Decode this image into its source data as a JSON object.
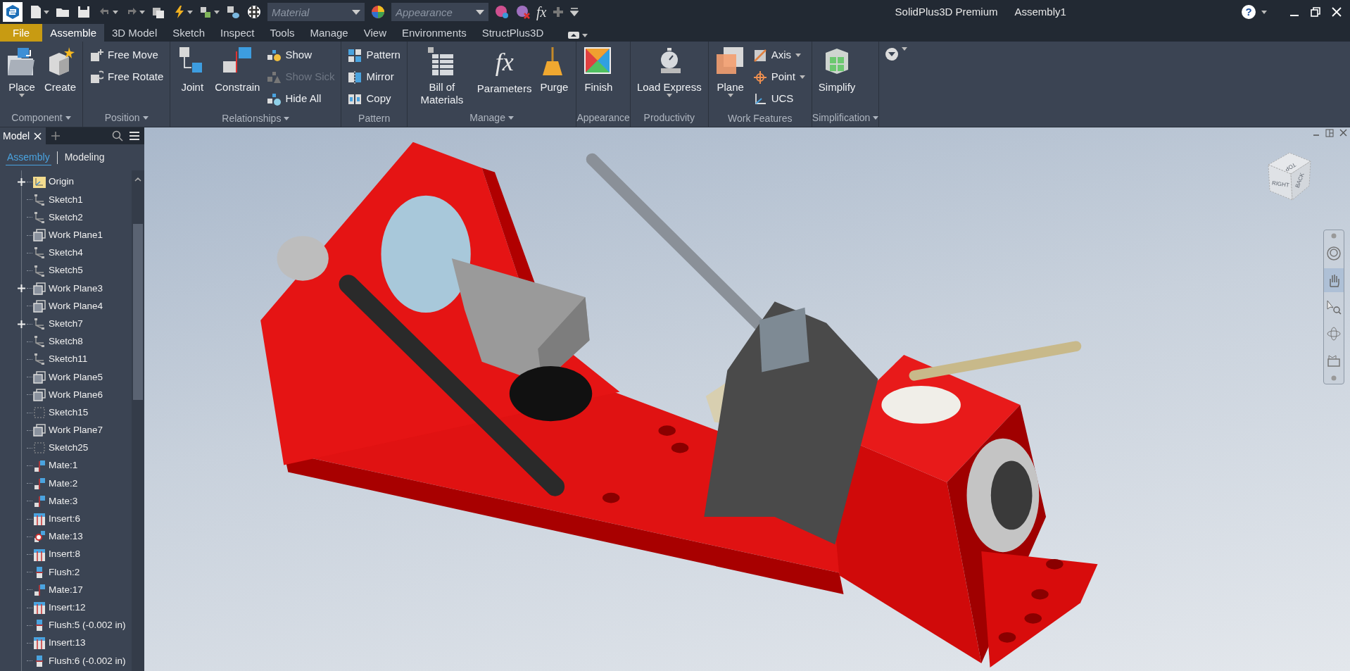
{
  "title_bar": {
    "material_placeholder": "Material",
    "appearance_placeholder": "Appearance",
    "fx_glyph": "fx",
    "app_name": "SolidPlus3D Premium",
    "document": "Assembly1",
    "help": "?"
  },
  "tabs": [
    {
      "label": "File",
      "kind": "file",
      "selected": false
    },
    {
      "label": "Assemble",
      "kind": "tab",
      "selected": true
    },
    {
      "label": "3D Model",
      "kind": "tab",
      "selected": false
    },
    {
      "label": "Sketch",
      "kind": "tab",
      "selected": false
    },
    {
      "label": "Inspect",
      "kind": "tab",
      "selected": false
    },
    {
      "label": "Tools",
      "kind": "tab",
      "selected": false
    },
    {
      "label": "Manage",
      "kind": "tab",
      "selected": false
    },
    {
      "label": "View",
      "kind": "tab",
      "selected": false
    },
    {
      "label": "Environments",
      "kind": "tab",
      "selected": false
    },
    {
      "label": "StructPlus3D",
      "kind": "tab",
      "selected": false
    }
  ],
  "ribbon": {
    "panels": [
      {
        "label": "Component",
        "dropdown": true,
        "tools": [
          {
            "kind": "large",
            "label": "Place",
            "caret": true
          },
          {
            "kind": "large",
            "label": "Create",
            "caret": false
          }
        ]
      },
      {
        "label": "Position",
        "dropdown": true,
        "tools": [
          {
            "kind": "stack",
            "items": [
              {
                "label": "Free Move",
                "disabled": false,
                "caret": false
              },
              {
                "label": "Free Rotate",
                "disabled": false,
                "caret": false
              }
            ]
          }
        ]
      },
      {
        "label": "Relationships",
        "dropdown": true,
        "tools": [
          {
            "kind": "large",
            "label": "Joint",
            "caret": false
          },
          {
            "kind": "large",
            "label": "Constrain",
            "caret": false
          },
          {
            "kind": "stack",
            "items": [
              {
                "label": "Show",
                "disabled": false,
                "caret": false
              },
              {
                "label": "Show Sick",
                "disabled": true,
                "caret": false
              },
              {
                "label": "Hide All",
                "disabled": false,
                "caret": false
              }
            ]
          }
        ]
      },
      {
        "label": "Pattern",
        "dropdown": false,
        "tools": [
          {
            "kind": "stack",
            "items": [
              {
                "label": "Pattern",
                "disabled": false,
                "caret": false
              },
              {
                "label": "Mirror",
                "disabled": false,
                "caret": false
              },
              {
                "label": "Copy",
                "disabled": false,
                "caret": false
              }
            ]
          }
        ]
      },
      {
        "label": "Manage",
        "dropdown": true,
        "tools": [
          {
            "kind": "large",
            "label": "Bill of Materials",
            "caret": false
          },
          {
            "kind": "large",
            "label": "Parameters",
            "glyph": "fx",
            "caret": false
          },
          {
            "kind": "large",
            "label": "Purge",
            "caret": false
          }
        ]
      },
      {
        "label": "Appearance",
        "dropdown": false,
        "tools": [
          {
            "kind": "large",
            "label": "Finish",
            "caret": false
          }
        ]
      },
      {
        "label": "Productivity",
        "dropdown": false,
        "tools": [
          {
            "kind": "large",
            "label": "Load Express",
            "caret": true
          }
        ]
      },
      {
        "label": "Work Features",
        "dropdown": false,
        "tools": [
          {
            "kind": "large",
            "label": "Plane",
            "caret": true
          },
          {
            "kind": "stack",
            "items": [
              {
                "label": "Axis",
                "disabled": false,
                "caret": true
              },
              {
                "label": "Point",
                "disabled": false,
                "caret": true
              },
              {
                "label": "UCS",
                "disabled": false,
                "caret": false
              }
            ]
          }
        ]
      },
      {
        "label": "Simplification",
        "dropdown": true,
        "tools": [
          {
            "kind": "large",
            "label": "Simplify",
            "caret": false
          }
        ]
      }
    ]
  },
  "browser": {
    "tab": "Model",
    "subtabs": [
      {
        "label": "Assembly",
        "selected": true
      },
      {
        "label": "Modeling",
        "selected": false
      }
    ],
    "items": [
      {
        "label": "Origin",
        "kind": "origin",
        "expandable": true
      },
      {
        "label": "Sketch1",
        "kind": "sketch",
        "expandable": false
      },
      {
        "label": "Sketch2",
        "kind": "sketch",
        "expandable": false
      },
      {
        "label": "Work Plane1",
        "kind": "plane",
        "expandable": false
      },
      {
        "label": "Sketch4",
        "kind": "sketch",
        "expandable": false
      },
      {
        "label": "Sketch5",
        "kind": "sketch",
        "expandable": false
      },
      {
        "label": "Work Plane3",
        "kind": "plane",
        "expandable": true
      },
      {
        "label": "Work Plane4",
        "kind": "plane",
        "expandable": false
      },
      {
        "label": "Sketch7",
        "kind": "sketch",
        "expandable": true
      },
      {
        "label": "Sketch8",
        "kind": "sketch",
        "expandable": false
      },
      {
        "label": "Sketch11",
        "kind": "sketch",
        "expandable": false
      },
      {
        "label": "Work Plane5",
        "kind": "plane",
        "expandable": false
      },
      {
        "label": "Work Plane6",
        "kind": "plane",
        "expandable": false
      },
      {
        "label": "Sketch15",
        "kind": "sketch-frame",
        "expandable": false
      },
      {
        "label": "Work Plane7",
        "kind": "plane",
        "expandable": false
      },
      {
        "label": "Sketch25",
        "kind": "sketch-frame",
        "expandable": false
      },
      {
        "label": "Mate:1",
        "kind": "mate",
        "expandable": false
      },
      {
        "label": "Mate:2",
        "kind": "mate",
        "expandable": false
      },
      {
        "label": "Mate:3",
        "kind": "mate",
        "expandable": false
      },
      {
        "label": "Insert:6",
        "kind": "insert",
        "expandable": false
      },
      {
        "label": "Mate:13",
        "kind": "point-mate",
        "expandable": false
      },
      {
        "label": "Insert:8",
        "kind": "insert",
        "expandable": false
      },
      {
        "label": "Flush:2",
        "kind": "flush",
        "expandable": false
      },
      {
        "label": "Mate:17",
        "kind": "mate",
        "expandable": false
      },
      {
        "label": "Insert:12",
        "kind": "insert",
        "expandable": false
      },
      {
        "label": "Flush:5 (-0.002 in)",
        "kind": "flush",
        "expandable": false
      },
      {
        "label": "Insert:13",
        "kind": "insert",
        "expandable": false
      },
      {
        "label": "Flush:6 (-0.002 in)",
        "kind": "flush",
        "expandable": false
      }
    ]
  },
  "viewport": {
    "viewcube": {
      "top": "TOP",
      "right": "RIGHT",
      "back": "BACK"
    },
    "nav_tools": [
      {
        "kind": "wheel",
        "selected": false
      },
      {
        "kind": "pan",
        "selected": true
      },
      {
        "kind": "zoom",
        "selected": false
      },
      {
        "kind": "orbit",
        "selected": false
      },
      {
        "kind": "look",
        "selected": false
      }
    ]
  }
}
